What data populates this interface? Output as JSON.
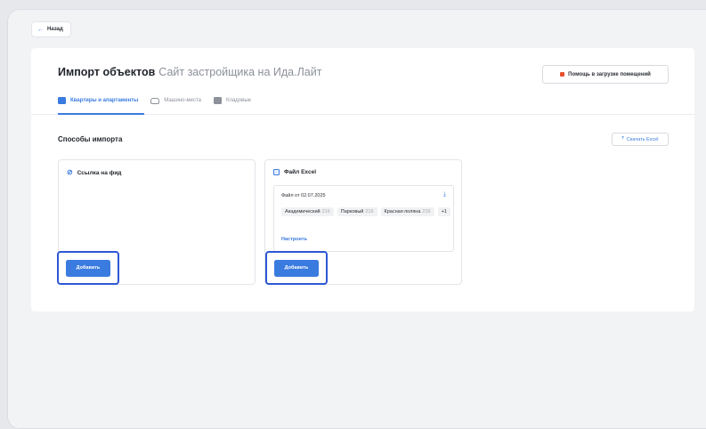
{
  "back_button": {
    "label": "Назад",
    "icon": "arrow-left-icon"
  },
  "header": {
    "title": "Импорт объектов",
    "subtitle": "Сайт застройщика на Ида.Лайт",
    "help_button": "Помощь в загрузке помещений"
  },
  "tabs": [
    {
      "label": "Квартиры и апартаменты",
      "icon": "apartment-icon",
      "active": true
    },
    {
      "label": "Машино-места",
      "icon": "car-icon",
      "active": false
    },
    {
      "label": "Кладовые",
      "icon": "storage-icon",
      "active": false
    }
  ],
  "section": {
    "title": "Способы импорта",
    "download_button": "Скачать Excel"
  },
  "methods": {
    "feed": {
      "title": "Ссылка на фид",
      "add_button": "Добавить",
      "icon": "link-icon"
    },
    "excel": {
      "title": "Файл Excel",
      "icon": "excel-file-icon",
      "file_label": "Файл от 02.07.2025",
      "objects": [
        {
          "name": "Академический",
          "count": "216"
        },
        {
          "name": "Парковый",
          "count": "216"
        },
        {
          "name": "Красная поляна",
          "count": "216"
        }
      ],
      "more": "+1",
      "configure_link": "Настроить",
      "add_button": "Добавить"
    }
  },
  "colors": {
    "accent": "#3a7be0",
    "highlight": "#2d57d4",
    "help_flag": "#e8522f"
  }
}
